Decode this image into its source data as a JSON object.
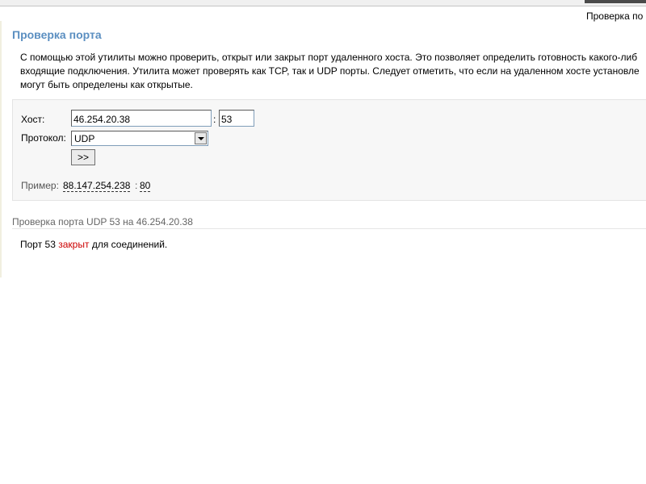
{
  "breadcrumb": "Проверка по",
  "page_title": "Проверка порта",
  "description": {
    "line1": "С помощью этой утилиты можно проверить, открыт или закрыт порт удаленного хоста. Это позволяет определить готовность какого-либ",
    "line2": "входящие подключения. Утилита может проверять как TCP, так и UDP порты. Следует отметить, что если на удаленном хосте установле",
    "line3": "могут быть определены как открытые."
  },
  "form": {
    "host_label": "Хост:",
    "host_value": "46.254.20.38",
    "port_separator": ":",
    "port_value": "53",
    "protocol_label": "Протокол:",
    "protocol_selected": "UDP",
    "submit_label": ">>",
    "example_label": "Пример:",
    "example_host": "88.147.254.238",
    "example_separator": ":",
    "example_port": "80"
  },
  "result": {
    "header": "Проверка порта UDP 53 на 46.254.20.38",
    "text_prefix": "Порт 53",
    "status": "закрыт",
    "text_suffix": "для соединений."
  },
  "colors": {
    "title": "#5b8fc1",
    "status_closed": "#cc0000"
  },
  "icons": {
    "select_arrow": "chevron-down-icon"
  }
}
